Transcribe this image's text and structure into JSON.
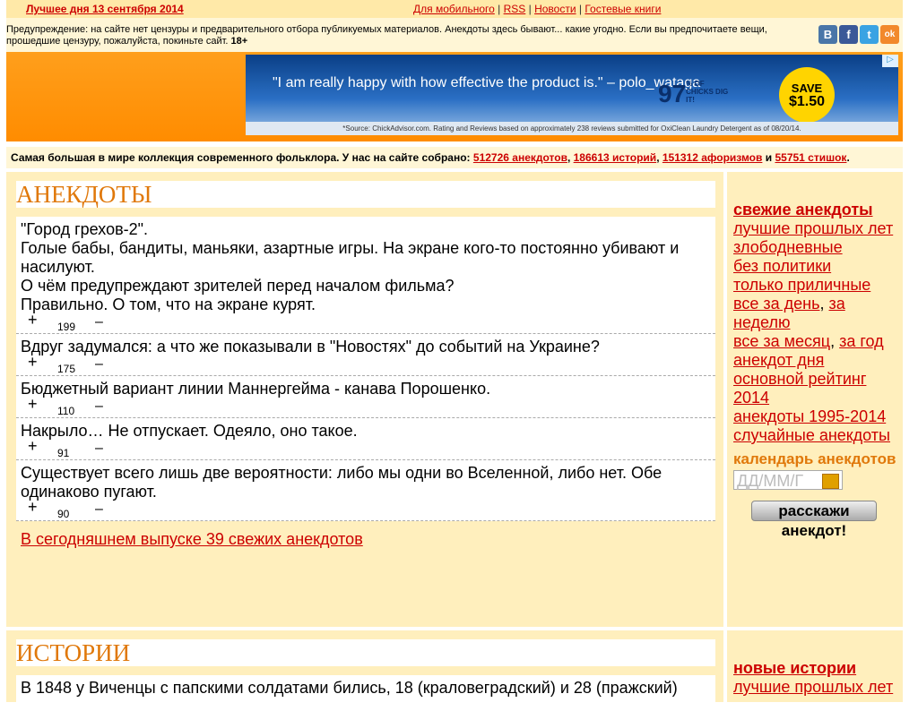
{
  "topbar": {
    "best_day": "Лучшее дня 13 сентября 2014",
    "links": [
      "Для мобильного",
      "RSS",
      "Новости",
      "Гостевые книги"
    ]
  },
  "warning": {
    "text": "Предупреждение: на сайте нет цензуры и предварительного отбора публикуемых материалов. Анекдоты здесь бывают... какие угодно. Если вы предпочитаете вещи, прошедшие цензуру, пожалуйста, покиньте сайт.",
    "age": "18+"
  },
  "social": [
    "В",
    "f",
    "t",
    "ok"
  ],
  "ad": {
    "quote": "\"I am really happy with how effective the product is.\" – polo_wataga",
    "percent": "97",
    "percent_caption": "% OF CHICKS DIG IT!",
    "save_label": "SAVE",
    "save_amount": "$1.50",
    "footer": "*Source: ChickAdvisor.com. Rating and Reviews based on approximately 238 reviews submitted for OxiClean Laundry Detergent as of 08/20/14."
  },
  "stats": {
    "prefix": "Самая большая в мире коллекция современного фольклора. У нас на сайте собрано:",
    "jokes": "512726 анекдотов",
    "stories": "186613 историй",
    "aphorisms": "151312 афоризмов",
    "and": "и",
    "poems": "55751 стишок",
    "suffix": "."
  },
  "jokes_section": {
    "title": "АНЕКДОТЫ",
    "items": [
      {
        "lines": [
          "\"Город грехов-2\".",
          "Голые бабы, бандиты, маньяки, азартные игры. На экране кого-то постоянно убивают и насилуют.",
          "О чём предупреждают зрителей перед началом фильма?",
          "Правильно. О том, что на экране курят."
        ],
        "score": "199"
      },
      {
        "lines": [
          "Вдруг задумался: а что же показывали в \"Новостях\" до событий на Украине?"
        ],
        "score": "175"
      },
      {
        "lines": [
          "Бюджетный вариант линии Маннергейма - канава Порошенко."
        ],
        "score": "110"
      },
      {
        "lines": [
          "Накрыло… Не отпускает. Одеяло, оно такое."
        ],
        "score": "91"
      },
      {
        "lines": [
          "Существует всего лишь две вероятности: либо мы одни во Вселенной, либо нет. Обе одинаково пугают."
        ],
        "score": "90"
      }
    ],
    "plus": "+",
    "minus": "–",
    "more_link": "В сегодняшнем выпуске 39 свежих анекдотов"
  },
  "sidebar": {
    "fresh": "свежие анекдоты",
    "best_past": "лучшие прошлых лет",
    "topical": "злободневные",
    "no_politics": "без политики",
    "decent": "только приличные",
    "all_day": "все за день",
    "week": "за неделю",
    "all_month": "все за месяц",
    "year": "за год",
    "joke_of_day": "анекдот дня",
    "main_rating": "основной рейтинг 2014",
    "years": "анекдоты 1995-2014",
    "random": "случайные анекдоты",
    "calendar": "календарь анекдотов",
    "date_placeholder": "ДД/ММ/Г",
    "tell_line1": "расскажи",
    "tell_line2": "анекдот!"
  },
  "stories_section": {
    "title": "ИСТОРИИ",
    "first_line": "В 1848 у Виченцы с папскими солдатами бились, 18 (краловеградский) и 28 (пражский)"
  },
  "sidebar2": {
    "new_stories": "новые истории",
    "best_past": "лучшие прошлых лет"
  }
}
